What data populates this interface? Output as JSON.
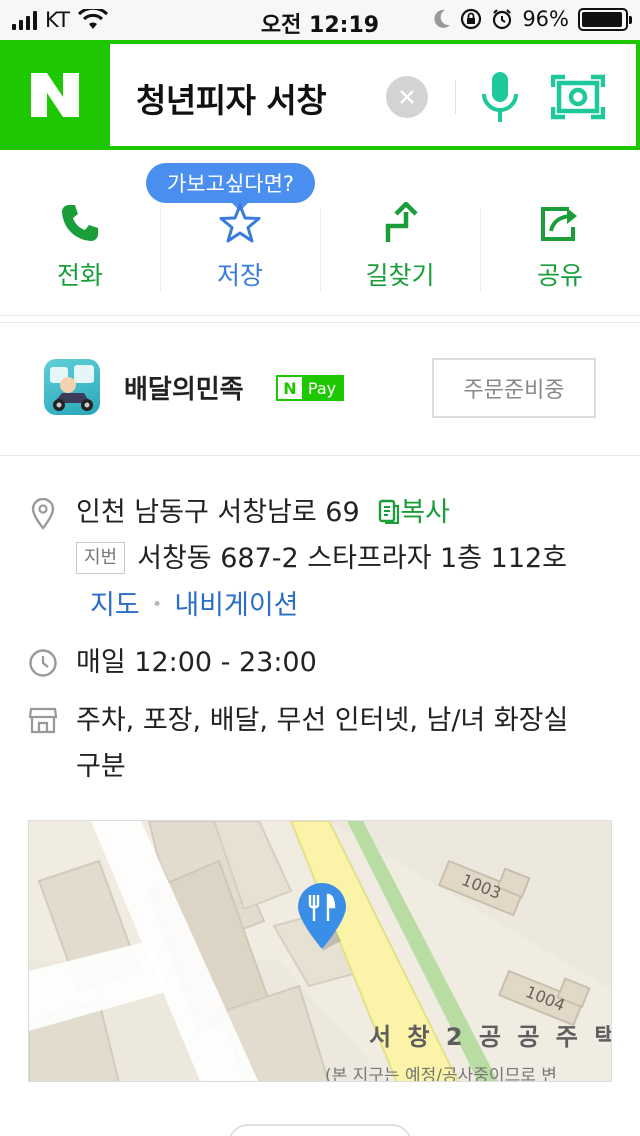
{
  "status_bar": {
    "carrier": "KT",
    "time": "오전 12:19",
    "battery_percent": "96%",
    "battery_level": 0.96
  },
  "search": {
    "logo": "N",
    "query": "청년피자 서창",
    "brand_color": "#1ec800"
  },
  "tooltip": "가보고싶다면?",
  "actions": [
    {
      "label": "전화",
      "icon": "phone-icon"
    },
    {
      "label": "저장",
      "icon": "star-icon"
    },
    {
      "label": "길찾기",
      "icon": "directions-icon"
    },
    {
      "label": "공유",
      "icon": "share-icon"
    }
  ],
  "delivery": {
    "app_name": "배달의민족",
    "npay_n": "N",
    "npay_text": "Pay",
    "order_status": "주문준비중"
  },
  "info": {
    "address": "인천 남동구 서창남로 69",
    "copy_label": "복사",
    "jibun_label": "지번",
    "jibun_address": "서창동 687-2 스타프라자 1층 112호",
    "map_link": "지도",
    "navigation_link": "내비게이션",
    "hours": "매일 12:00 - 23:00",
    "amenities": "주차, 포장, 배달, 무선 인터넷, 남/녀 화장실 구분"
  },
  "map": {
    "building_1": "1003",
    "building_2": "1004",
    "area_label": "서 창 2 공 공 주 택",
    "notice": "(본 지구는 예정/공사중이므로 변"
  },
  "colors": {
    "green_action": "#1a9e3a",
    "blue_action": "#3a7be0",
    "link_blue": "#2a6ec6",
    "pin_blue": "#3a8ee6"
  }
}
